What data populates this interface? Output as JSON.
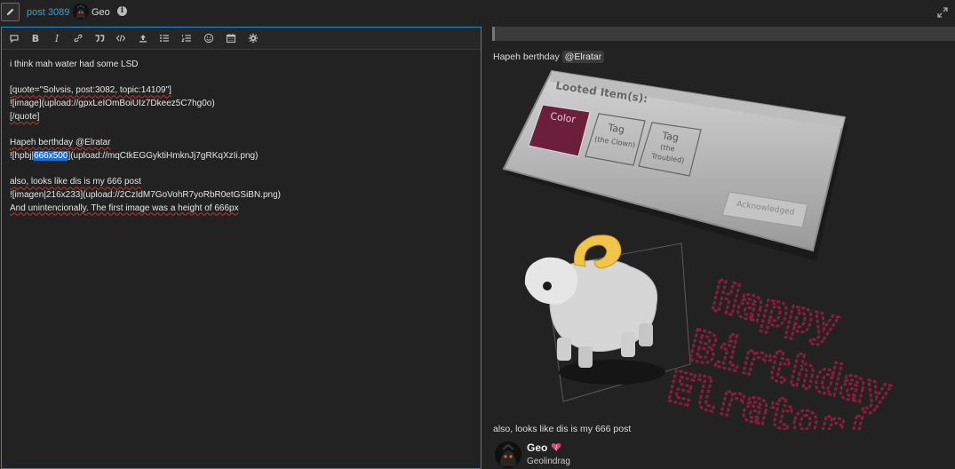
{
  "header": {
    "post_link": "post 3089",
    "username": "Geo",
    "info": "i",
    "icons": [
      "pencil-icon",
      "info-icon",
      "expand-icon"
    ]
  },
  "toolbar": {
    "buttons": [
      "quote-bubble-icon",
      "bold-icon",
      "italic-icon",
      "link-icon",
      "blockquote-icon",
      "code-icon",
      "upload-icon",
      "bullet-list-icon",
      "numbered-list-icon",
      "emoji-icon",
      "calendar-icon",
      "gear-icon"
    ],
    "bold": "B",
    "italic": "I"
  },
  "editor": {
    "line1": "i think mah water had some LSD",
    "line2": "[quote=\"Solvsis, post:3082, topic:14109\"]",
    "line3": "![image](upload://gpxLeIOmBoiUIz7Dkeez5C7hg0o)",
    "line4": "[/quote]",
    "line5": "Hapeh berthday @Elratar",
    "line6_pre": "![hpbj|",
    "line6_sel": "666x500",
    "line6_post": "](upload://mqCtkEGGyktiHmknJj7gRKqXzIi.png)",
    "line7": "also, looks like dis is my 666 post",
    "line8": "![imagen|216x233](upload://2CzIdM7GoVohR7yoRbR0etGSiBN.png)",
    "line9": "And unintencionally. The first image was a height of 666px"
  },
  "preview": {
    "birthday_text": "Hapeh berthday",
    "mention": "@Elratar",
    "image": {
      "panel_title": "Looted Item(s):",
      "color_btn": "Color",
      "tag1_a": "Tag",
      "tag1_b": "(the Clown)",
      "tag2_a": "Tag",
      "tag2_b": "(the",
      "tag2_c": "Troubled)",
      "ack": "Acknowledged",
      "hb1": "Happy",
      "hb2": "Birthday",
      "hb3": "Elrator!"
    },
    "post_line": "also, looks like dis is my 666 post",
    "author_name": "Geo",
    "author_sub": "Geolindrag"
  },
  "colors": {
    "accent_blue": "#1f8ccf",
    "link_blue": "#3aa0e0",
    "selection": "#1f6fd1",
    "pixel_text": "#8a1c3c"
  }
}
